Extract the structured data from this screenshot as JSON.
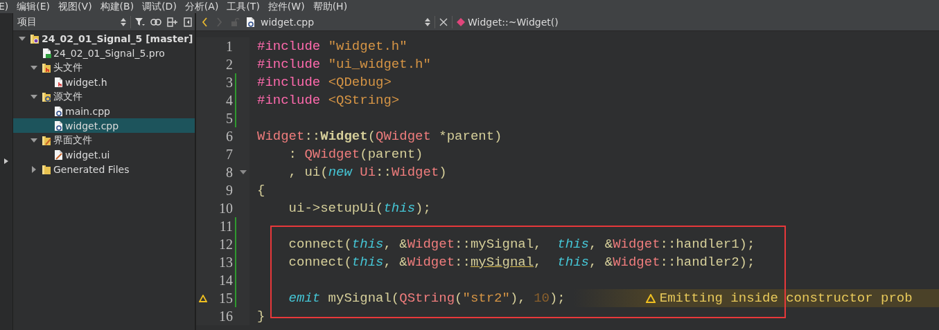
{
  "menu_bar": {
    "items": [
      {
        "label": "E)"
      },
      {
        "label": "编辑(E)"
      },
      {
        "label": "视图(V)"
      },
      {
        "label": "构建(B)"
      },
      {
        "label": "调试(D)"
      },
      {
        "label": "分析(A)"
      },
      {
        "label": "工具(T)"
      },
      {
        "label": "控件(W)"
      },
      {
        "label": "帮助(H)"
      }
    ]
  },
  "sidebar": {
    "title": "项目",
    "tree": [
      {
        "label": "24_02_01_Signal_5 [master]",
        "kind": "project",
        "expanded": true,
        "selected": false,
        "children": [
          {
            "label": "24_02_01_Signal_5.pro",
            "kind": "pro-file",
            "selected": false
          },
          {
            "label": "头文件",
            "kind": "header-folder",
            "expanded": true,
            "selected": false,
            "children": [
              {
                "label": "widget.h",
                "kind": "header-file",
                "selected": false
              }
            ]
          },
          {
            "label": "源文件",
            "kind": "source-folder",
            "expanded": true,
            "selected": false,
            "children": [
              {
                "label": "main.cpp",
                "kind": "source-file",
                "selected": false
              },
              {
                "label": "widget.cpp",
                "kind": "source-file",
                "selected": true
              }
            ]
          },
          {
            "label": "界面文件",
            "kind": "form-folder",
            "expanded": true,
            "selected": false,
            "children": [
              {
                "label": "widget.ui",
                "kind": "form-file",
                "selected": false
              }
            ]
          },
          {
            "label": "Generated Files",
            "kind": "folder",
            "expanded": false,
            "selected": false
          }
        ]
      }
    ]
  },
  "editor": {
    "toolbar": {
      "back_disabled": false,
      "forward_disabled": true,
      "file_name": "widget.cpp",
      "symbol": "Widget::~Widget()"
    },
    "line_groups": [
      {
        "highlighted": false,
        "lines": [
          {
            "number": "1",
            "changed": false,
            "foldable": false,
            "tokens": [
              {
                "text": "#include ",
                "kind": "preproc"
              },
              {
                "text": "\"widget.h\"",
                "kind": "string"
              }
            ]
          },
          {
            "number": "2",
            "changed": false,
            "foldable": false,
            "tokens": [
              {
                "text": "#include ",
                "kind": "preproc"
              },
              {
                "text": "\"ui_widget.h\"",
                "kind": "string"
              }
            ]
          },
          {
            "number": "3",
            "changed": true,
            "foldable": false,
            "tokens": [
              {
                "text": "#include ",
                "kind": "preproc"
              },
              {
                "text": "<QDebug>",
                "kind": "string"
              }
            ]
          },
          {
            "number": "4",
            "changed": true,
            "foldable": false,
            "tokens": [
              {
                "text": "#include ",
                "kind": "preproc"
              },
              {
                "text": "<QString>",
                "kind": "string"
              }
            ]
          },
          {
            "number": "5",
            "changed": true,
            "foldable": false
          },
          {
            "number": "6",
            "changed": false,
            "foldable": false,
            "tokens": [
              {
                "text": "Widget",
                "kind": "type"
              },
              {
                "text": "::",
                "kind": "plain"
              },
              {
                "text": "Widget",
                "kind": "function"
              },
              {
                "text": "(",
                "kind": "plain"
              },
              {
                "text": "QWidget",
                "kind": "type"
              },
              {
                "text": " *parent)",
                "kind": "plain"
              }
            ]
          },
          {
            "number": "7",
            "changed": false,
            "foldable": false,
            "tokens": [
              {
                "text": "    : ",
                "kind": "plain"
              },
              {
                "text": "QWidget",
                "kind": "type"
              },
              {
                "text": "(parent)",
                "kind": "plain"
              }
            ]
          },
          {
            "number": "8",
            "changed": false,
            "foldable": true,
            "tokens": [
              {
                "text": "    , ui(",
                "kind": "plain"
              },
              {
                "text": "new",
                "kind": "keyword"
              },
              {
                "text": " Ui",
                "kind": "type"
              },
              {
                "text": "::",
                "kind": "plain"
              },
              {
                "text": "Widget",
                "kind": "type"
              },
              {
                "text": ")",
                "kind": "plain"
              }
            ]
          },
          {
            "number": "9",
            "changed": false,
            "foldable": false,
            "tokens": [
              {
                "text": "{",
                "kind": "plain"
              }
            ]
          },
          {
            "number": "10",
            "changed": false,
            "foldable": false,
            "tokens": [
              {
                "text": "    ui->setupUi(",
                "kind": "plain"
              },
              {
                "text": "this",
                "kind": "keyword"
              },
              {
                "text": ");",
                "kind": "plain"
              }
            ]
          },
          {
            "number": "11",
            "changed": true,
            "foldable": false
          }
        ]
      },
      {
        "highlighted": true,
        "lines": [
          {
            "number": "12",
            "changed": true,
            "foldable": false,
            "tokens": [
              {
                "text": "    connect(",
                "kind": "plain"
              },
              {
                "text": "this",
                "kind": "keyword"
              },
              {
                "text": ", &",
                "kind": "plain"
              },
              {
                "text": "Widget",
                "kind": "type"
              },
              {
                "text": "::mySignal,  ",
                "kind": "plain"
              },
              {
                "text": "this",
                "kind": "keyword"
              },
              {
                "text": ", &",
                "kind": "plain"
              },
              {
                "text": "Widget",
                "kind": "type"
              },
              {
                "text": "::handler1);",
                "kind": "plain"
              }
            ]
          },
          {
            "number": "13",
            "changed": true,
            "foldable": false,
            "tokens": [
              {
                "text": "    connect(",
                "kind": "plain"
              },
              {
                "text": "this",
                "kind": "keyword"
              },
              {
                "text": ", &",
                "kind": "plain"
              },
              {
                "text": "Widget",
                "kind": "type"
              },
              {
                "text": "::",
                "kind": "plain"
              },
              {
                "text": "mySignal",
                "kind": "underlined"
              },
              {
                "text": ",  ",
                "kind": "plain"
              },
              {
                "text": "this",
                "kind": "keyword"
              },
              {
                "text": ", &",
                "kind": "plain"
              },
              {
                "text": "Widget",
                "kind": "type"
              },
              {
                "text": "::handler2);",
                "kind": "plain"
              }
            ]
          },
          {
            "number": "14",
            "changed": true,
            "foldable": false
          },
          {
            "number": "15",
            "changed": true,
            "foldable": false,
            "warning": "Emitting inside constructor prob",
            "tokens": [
              {
                "text": "    emit",
                "kind": "keyword"
              },
              {
                "text": " mySignal(",
                "kind": "plain"
              },
              {
                "text": "QString",
                "kind": "type"
              },
              {
                "text": "(",
                "kind": "plain"
              },
              {
                "text": "\"str2\"",
                "kind": "string"
              },
              {
                "text": "), ",
                "kind": "plain"
              },
              {
                "text": "10",
                "kind": "number"
              },
              {
                "text": ");",
                "kind": "plain"
              }
            ]
          }
        ]
      },
      {
        "highlighted": false,
        "lines": [
          {
            "number": "16",
            "changed": false,
            "foldable": false,
            "tokens": [
              {
                "text": "}",
                "kind": "plain"
              }
            ]
          }
        ]
      }
    ]
  }
}
